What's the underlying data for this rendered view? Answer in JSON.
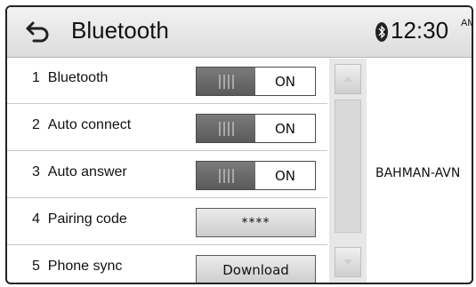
{
  "header": {
    "title": "Bluetooth",
    "time": "12:30",
    "ampm": "AM"
  },
  "settings": [
    {
      "number": "1",
      "label": "Bluetooth",
      "control": "toggle",
      "value": "ON"
    },
    {
      "number": "2",
      "label": "Auto connect",
      "control": "toggle",
      "value": "ON"
    },
    {
      "number": "3",
      "label": "Auto answer",
      "control": "toggle",
      "value": "ON"
    },
    {
      "number": "4",
      "label": "Pairing code",
      "control": "button",
      "value": "****"
    },
    {
      "number": "5",
      "label": "Phone sync",
      "control": "button",
      "value": "Download"
    }
  ],
  "device_name": "BAHMAN-AVN",
  "icons": {
    "back": "back-arrow-icon",
    "bluetooth": "bluetooth-icon",
    "scroll_up": "scroll-up-icon",
    "scroll_down": "scroll-down-icon"
  },
  "colors": {
    "header_bg": "#e4e4e4",
    "toggle_off": "#6a6a6a",
    "toggle_on": "#ffffff"
  }
}
